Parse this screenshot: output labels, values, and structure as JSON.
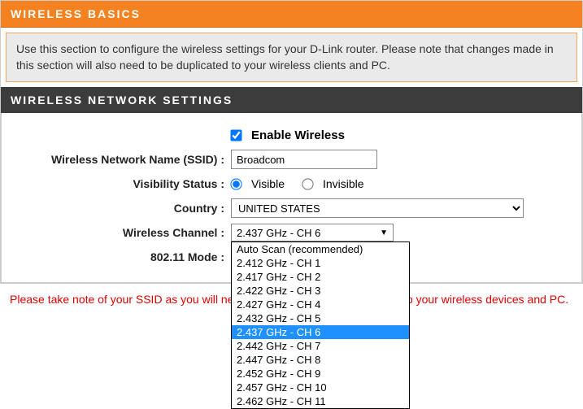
{
  "basics": {
    "header": "WIRELESS BASICS",
    "desc": "Use this section to configure the wireless settings for your D-Link router. Please note that changes made in this section will also need to be duplicated to your wireless clients and PC."
  },
  "settings": {
    "header": "WIRELESS NETWORK SETTINGS",
    "enable_label": "Enable Wireless",
    "enable_checked": true,
    "ssid_label": "Wireless Network Name (SSID) :",
    "ssid_value": "Broadcom",
    "visibility_label": "Visibility Status :",
    "visibility_visible": "Visible",
    "visibility_invisible": "Invisible",
    "visibility_value": "visible",
    "country_label": "Country :",
    "country_value": "UNITED STATES",
    "channel_label": "Wireless Channel :",
    "channel_value": "2.437 GHz - CH 6",
    "channel_options": [
      "Auto Scan (recommended)",
      "2.412 GHz - CH 1",
      "2.417 GHz - CH 2",
      "2.422 GHz - CH 3",
      "2.427 GHz - CH 4",
      "2.432 GHz - CH 5",
      "2.437 GHz - CH 6",
      "2.442 GHz - CH 7",
      "2.447 GHz - CH 8",
      "2.452 GHz - CH 9",
      "2.457 GHz - CH 10",
      "2.462 GHz - CH 11"
    ],
    "channel_selected_index": 6,
    "mode_label": "802.11 Mode :"
  },
  "footer_note": "Please take note of your SSID as you will need to duplicate the same settings to your wireless devices and PC."
}
